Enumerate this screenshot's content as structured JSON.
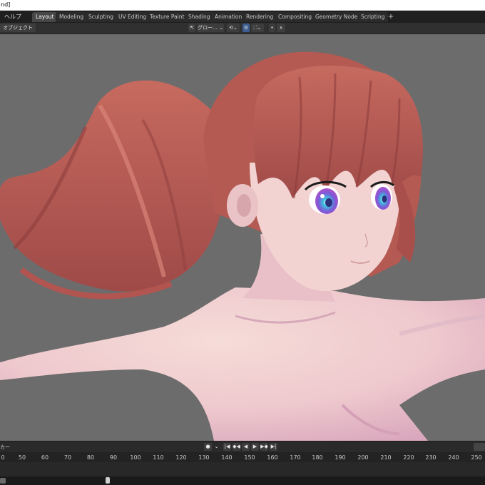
{
  "window": {
    "title_fragment": "nd]"
  },
  "menu": {
    "help_label": "ヘルプ"
  },
  "workspace_tabs": [
    {
      "label": "Layout",
      "active": true
    },
    {
      "label": "Modeling",
      "active": false
    },
    {
      "label": "Sculpting",
      "active": false
    },
    {
      "label": "UV Editing",
      "active": false
    },
    {
      "label": "Texture Paint",
      "active": false
    },
    {
      "label": "Shading",
      "active": false
    },
    {
      "label": "Animation",
      "active": false
    },
    {
      "label": "Rendering",
      "active": false
    },
    {
      "label": "Compositing",
      "active": false
    },
    {
      "label": "Geometry Nodes",
      "active": false
    },
    {
      "label": "Scripting",
      "active": false
    }
  ],
  "add_tab_label": "+",
  "viewport_header": {
    "mode_label": "オブジェクト",
    "orientation_label": "グロー...",
    "orientation_dropdown": "⌄",
    "snap_label": "⟲⌄",
    "overlay_label": "⛶⌄",
    "proportional_label": "∧"
  },
  "colors": {
    "viewport_bg": "#6c6c6c",
    "hair": "#b75a52",
    "skin": "#f0cfcf",
    "skin_shadow": "#d9a7bd",
    "iris": "#b94fd1",
    "iris_inner": "#29b6d6",
    "active_tab": "#474747",
    "accent_blue": "#3c5d8f"
  },
  "timeline": {
    "marker_label": "カー",
    "keyframe_dot": "●",
    "keyframe_dropdown": "⌄",
    "playback_buttons": [
      "|◀",
      "◆◀",
      "◀",
      "▶",
      "▶◆",
      "▶|"
    ],
    "frame_ticks": [
      "0",
      "50",
      "60",
      "70",
      "80",
      "90",
      "100",
      "110",
      "120",
      "130",
      "140",
      "150",
      "160",
      "170",
      "180",
      "190",
      "200",
      "210",
      "220",
      "230",
      "240",
      "250"
    ]
  }
}
